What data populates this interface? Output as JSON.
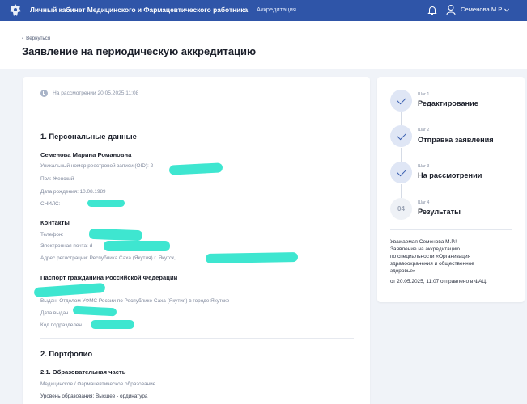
{
  "topbar": {
    "app_title": "Личный кабинет Медицинского и Фармацевтического работника",
    "nav_link": "Аккредитация",
    "user_name": "Семенова М.Р."
  },
  "header": {
    "back_label": "Вернуться",
    "page_title": "Заявление на периодическую аккредитацию"
  },
  "status": {
    "text": "На рассмотрении 20.05.2025 11:08"
  },
  "personal": {
    "title": "1. Персональные данные",
    "full_name": "Семенова Марина Романовна",
    "oid_label": "Уникальный номер реестровой записи (OID): 2",
    "gender": "Пол: Женский",
    "birth_date": "Дата рождения: 10.08.1989",
    "snils": "СНИЛС:"
  },
  "contacts": {
    "title": "Контакты",
    "phone": "Телефон:",
    "email": "Электронная почта: d",
    "address": "Адрес регистрации: Республика Саха (Якутия) г. Якутск,"
  },
  "passport": {
    "title": "Паспорт гражданина Российской Федерации",
    "issued_by": "Выдан: Отделом УФМС России по Республике Саха (Якутия) в городе Якутске",
    "issue_date": "Дата выдач",
    "division_code": "Код подразделен"
  },
  "portfolio": {
    "title": "2. Портфолио",
    "subtitle": "2.1. Образовательная часть",
    "type": "Медицинское / Фармацевтическое образование",
    "level": "Уровень образования: Высшее - ординатура"
  },
  "steps": [
    {
      "label": "Шаг 1",
      "name": "Редактирование",
      "state": "done"
    },
    {
      "label": "Шаг 2",
      "name": "Отправка заявления",
      "state": "done"
    },
    {
      "label": "Шаг 3",
      "name": "На рассмотрении",
      "state": "done"
    },
    {
      "label": "Шаг 4",
      "name": "Результаты",
      "state": "pending",
      "number": "04"
    }
  ],
  "notice": {
    "lines": [
      "Уважаемая Семенова М.Р.!",
      "Заявление на аккредитацию",
      "по специальности «Организация",
      "здравоохранения и общественное",
      "здоровье»",
      "от 20.05.2025, 11:07 отправлено в ФАЦ."
    ]
  },
  "colors": {
    "topbar": "#2f55a8",
    "redaction": "#3ee6d0",
    "step_done": "#dfe6f5",
    "check": "#3a5fb0"
  }
}
